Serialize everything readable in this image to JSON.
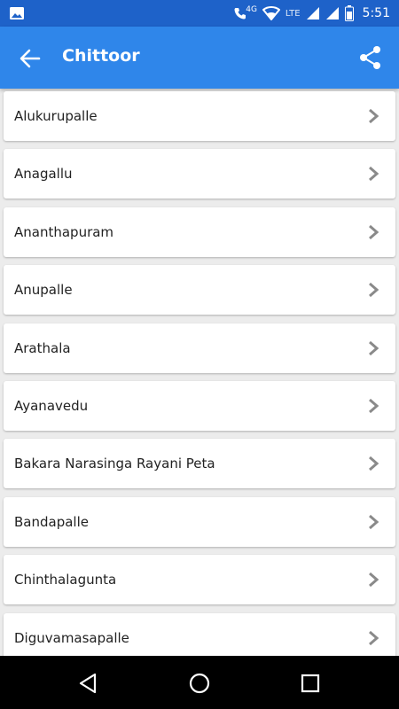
{
  "status_bar": {
    "network": "4G",
    "lte": "LTE",
    "time": "5:51",
    "icons": [
      "gallery-icon",
      "call-icon",
      "wifi-icon",
      "signal-icon",
      "signal-icon",
      "battery-icon"
    ]
  },
  "app_bar": {
    "title": "Chittoor",
    "back_icon": "arrow-back-icon",
    "share_icon": "share-icon"
  },
  "list": {
    "items": [
      {
        "label": "Alukurupalle"
      },
      {
        "label": "Anagallu"
      },
      {
        "label": "Ananthapuram"
      },
      {
        "label": "Anupalle"
      },
      {
        "label": "Arathala"
      },
      {
        "label": "Ayanavedu"
      },
      {
        "label": "Bakara Narasinga Rayani Peta"
      },
      {
        "label": "Bandapalle"
      },
      {
        "label": "Chinthalagunta"
      },
      {
        "label": "Diguvamasapalle"
      }
    ]
  },
  "nav_bar": {
    "icons": [
      "back-triangle-icon",
      "home-circle-icon",
      "recents-square-icon"
    ]
  },
  "colors": {
    "status_bar": "#1e62c9",
    "app_bar": "#2f86ea",
    "background": "#ececec",
    "chevron": "#8a8a8a"
  }
}
